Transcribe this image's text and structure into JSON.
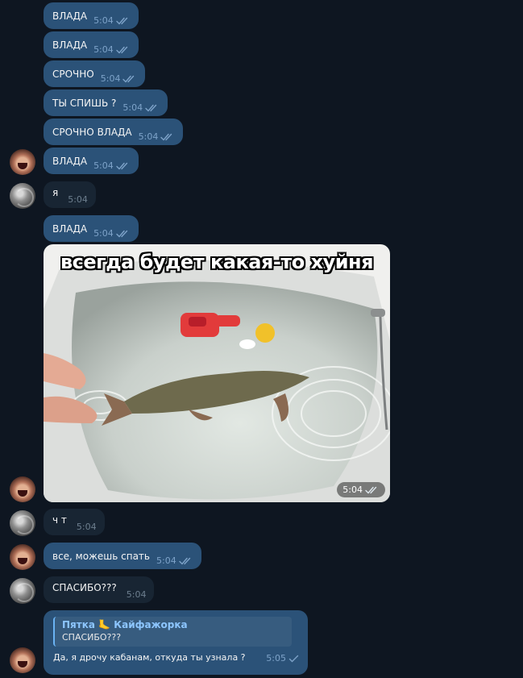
{
  "chat": {
    "messages": [
      {
        "text": "ВЛАДА",
        "time": "5:04"
      },
      {
        "text": "ВЛАДА",
        "time": "5:04"
      },
      {
        "text": "СРОЧНО",
        "time": "5:04"
      },
      {
        "text": "ТЫ СПИШЬ ?",
        "time": "5:04"
      },
      {
        "text": "СРОЧНО ВЛАДА",
        "time": "5:04"
      },
      {
        "text": "ВЛАДА",
        "time": "5:04"
      },
      {
        "text": "я",
        "time": "5:04"
      },
      {
        "text": "ВЛАДА",
        "time": "5:04"
      },
      {
        "caption": "всегда будет какая-то хуйня",
        "time": "5:04"
      },
      {
        "text": "ч т",
        "time": "5:04"
      },
      {
        "text": "все, можешь спать",
        "time": "5:04"
      },
      {
        "text": "СПАСИБО???",
        "time": "5:04"
      },
      {
        "reply_name": "Пятка",
        "reply_emoji": "🦶",
        "reply_name2": "Кайфажорка",
        "reply_text": "СПАСИБО???",
        "text": "Да, я дрочу кабанам, откуда ты узнала ?",
        "time": "5:05"
      }
    ]
  },
  "colors": {
    "background": "#0e1621",
    "outgoing_bubble": "#2b5278",
    "incoming_bubble": "#182533",
    "reply_accent": "#6ab3f3"
  },
  "icons": {
    "read_receipt": "double-check-icon",
    "sent_receipt": "check-icon"
  }
}
